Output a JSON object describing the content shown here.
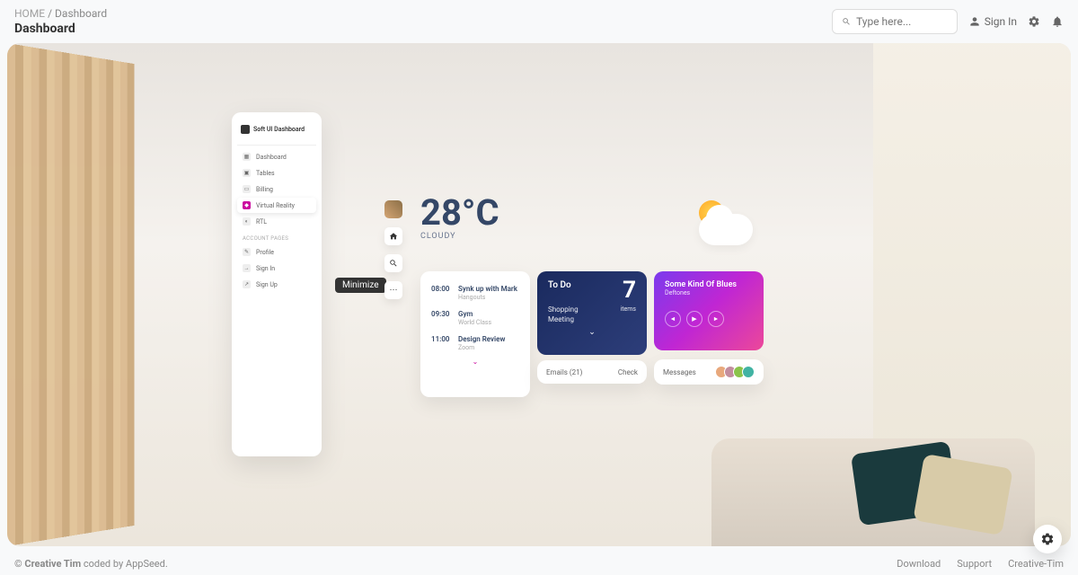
{
  "breadcrumb": {
    "home": "HOME",
    "current": "Dashboard"
  },
  "page_title": "Dashboard",
  "search": {
    "placeholder": "Type here..."
  },
  "signin_label": "Sign In",
  "sidebar": {
    "title": "Soft UI Dashboard",
    "items": [
      {
        "label": "Dashboard",
        "icon": "▦"
      },
      {
        "label": "Tables",
        "icon": "▣"
      },
      {
        "label": "Billing",
        "icon": "▭"
      },
      {
        "label": "Virtual Reality",
        "icon": "◆"
      },
      {
        "label": "RTL",
        "icon": "◐"
      }
    ],
    "section": "ACCOUNT PAGES",
    "account_items": [
      {
        "label": "Profile",
        "icon": "✎"
      },
      {
        "label": "Sign In",
        "icon": "→"
      },
      {
        "label": "Sign Up",
        "icon": "↗"
      }
    ]
  },
  "tooltip": "Minimize",
  "weather": {
    "temp": "28°C",
    "condition": "CLOUDY"
  },
  "schedule": [
    {
      "time": "08:00",
      "title": "Synk up with Mark",
      "sub": "Hangouts"
    },
    {
      "time": "09:30",
      "title": "Gym",
      "sub": "World Class"
    },
    {
      "time": "11:00",
      "title": "Design Review",
      "sub": "Zoom"
    }
  ],
  "todo": {
    "title": "To Do",
    "count": "7",
    "items_label": "items",
    "list": [
      "Shopping",
      "Meeting"
    ]
  },
  "emails": {
    "label": "Emails (21)",
    "action": "Check"
  },
  "music": {
    "title": "Some Kind Of Blues",
    "artist": "Deftones"
  },
  "messages_label": "Messages",
  "footer": {
    "copyright": "©",
    "brand": "Creative Tim",
    "suffix": " coded by AppSeed.",
    "links": [
      "Download",
      "Support",
      "Creative-Tim"
    ]
  }
}
